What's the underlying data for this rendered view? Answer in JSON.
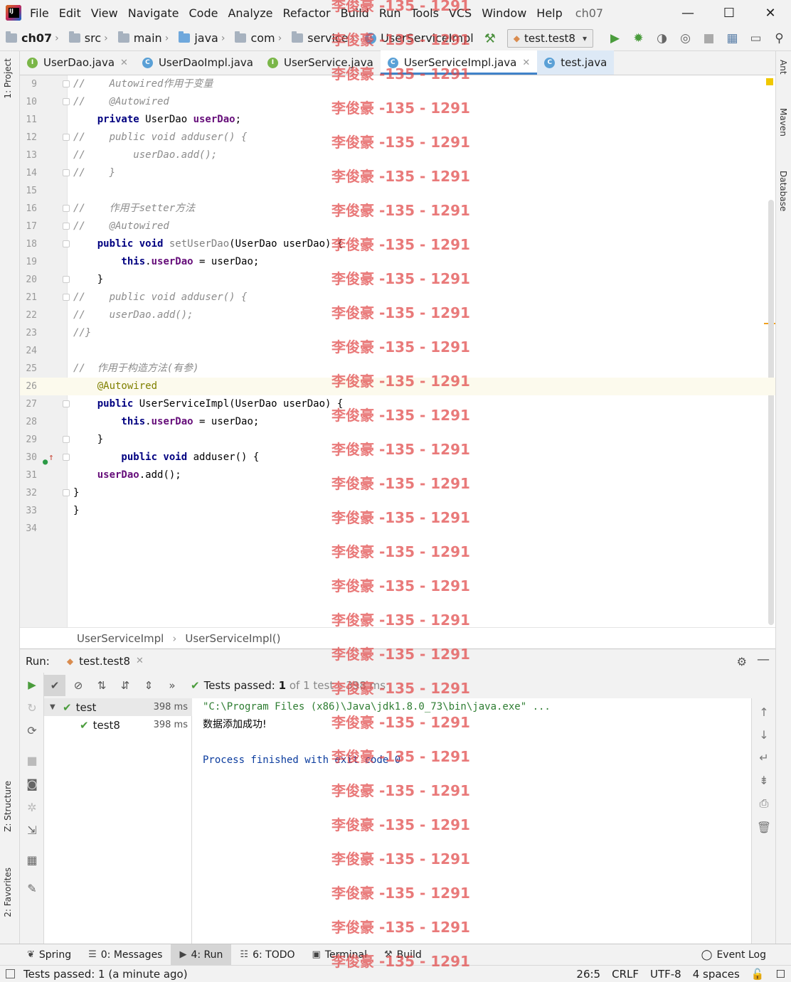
{
  "menu": {
    "items": [
      "File",
      "Edit",
      "View",
      "Navigate",
      "Code",
      "Analyze",
      "Refactor",
      "Build",
      "Run",
      "Tools",
      "VCS",
      "Window",
      "Help"
    ],
    "project": "ch07"
  },
  "nav": {
    "crumbs": [
      "ch07",
      "src",
      "main",
      "java",
      "com",
      "service",
      "UserServiceImpl"
    ],
    "run_config": "test.test8"
  },
  "tabs": [
    {
      "label": "UserDao.java",
      "type": "interface"
    },
    {
      "label": "UserDaoImpl.java",
      "type": "class"
    },
    {
      "label": "UserService.java",
      "type": "interface"
    },
    {
      "label": "UserServiceImpl.java",
      "type": "class"
    },
    {
      "label": "test.java",
      "type": "class"
    }
  ],
  "code_lines": [
    {
      "n": "9",
      "text": "//    Autowired作用于变量"
    },
    {
      "n": "10",
      "text": "//    @Autowired"
    },
    {
      "n": "11",
      "text": "    private UserDao userDao;"
    },
    {
      "n": "12",
      "text": "//    public void adduser() {"
    },
    {
      "n": "13",
      "text": "//        userDao.add();"
    },
    {
      "n": "14",
      "text": "//    }"
    },
    {
      "n": "15",
      "text": ""
    },
    {
      "n": "16",
      "text": "//    作用于setter方法"
    },
    {
      "n": "17",
      "text": "//    @Autowired"
    },
    {
      "n": "18",
      "text": "    public void setUserDao(UserDao userDao) {"
    },
    {
      "n": "19",
      "text": "        this.userDao = userDao;"
    },
    {
      "n": "20",
      "text": "    }"
    },
    {
      "n": "21",
      "text": "//    public void adduser() {"
    },
    {
      "n": "22",
      "text": "//    userDao.add();"
    },
    {
      "n": "23",
      "text": "//}"
    },
    {
      "n": "24",
      "text": ""
    },
    {
      "n": "25",
      "text": "//  作用于构造方法(有参)"
    },
    {
      "n": "26",
      "text": "    @Autowired"
    },
    {
      "n": "27",
      "text": "    public UserServiceImpl(UserDao userDao) {"
    },
    {
      "n": "28",
      "text": "        this.userDao = userDao;"
    },
    {
      "n": "29",
      "text": "    }"
    },
    {
      "n": "30",
      "text": "        public void adduser() {"
    },
    {
      "n": "31",
      "text": "    userDao.add();"
    },
    {
      "n": "32",
      "text": "}"
    },
    {
      "n": "33",
      "text": "}"
    },
    {
      "n": "34",
      "text": ""
    }
  ],
  "editor_breadcrumbs": [
    "UserServiceImpl",
    "UserServiceImpl()"
  ],
  "run_panel": {
    "title": "Run:",
    "tab": "test.test8",
    "status_prefix": "Tests passed:",
    "status_count": "1",
    "status_suffix": "of 1 test – 398 ms",
    "tree": [
      {
        "name": "test",
        "duration": "398 ms"
      },
      {
        "name": "test8",
        "duration": "398 ms"
      }
    ],
    "console": [
      "\"C:\\Program Files (x86)\\Java\\jdk1.8.0_73\\bin\\java.exe\" ...",
      "数据添加成功!",
      "",
      "Process finished with exit code 0"
    ]
  },
  "bottom_tabs": [
    "Spring",
    "0: Messages",
    "4: Run",
    "6: TODO",
    "Terminal",
    "Build"
  ],
  "event_log": "Event Log",
  "status": {
    "left": "Tests passed: 1 (a minute ago)",
    "position": "26:5",
    "line_sep": "CRLF",
    "encoding": "UTF-8",
    "indent": "4 spaces"
  },
  "side_tabs": {
    "left": [
      "1: Project",
      "Z: Structure",
      "2: Favorites"
    ],
    "right": [
      "Ant",
      "Maven",
      "Database"
    ]
  },
  "watermark": "李俊豪 -135 - 1291"
}
